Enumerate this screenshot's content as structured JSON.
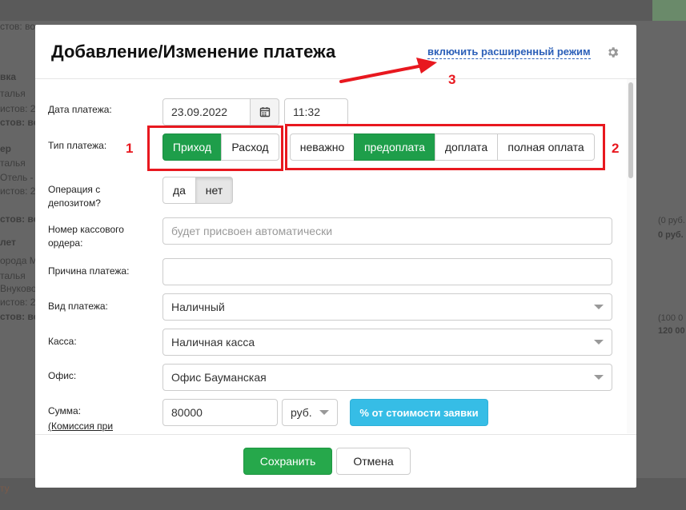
{
  "background": {
    "lines": [
      {
        "text": "стов: во",
        "top": 0
      },
      {
        "text": "вка",
        "top": 0
      },
      {
        "text": "талья",
        "top": 0
      },
      {
        "text": "истов: 2",
        "top": 0
      },
      {
        "text": "стов: во",
        "top": 0
      },
      {
        "text": "ер",
        "top": 0
      },
      {
        "text": "талья",
        "top": 0
      },
      {
        "text": "Отель -",
        "top": 0
      },
      {
        "text": "истов: 2",
        "top": 0
      },
      {
        "text": "стов: во",
        "top": 0
      },
      {
        "text": "лет",
        "top": 0
      },
      {
        "text": "орода М",
        "top": 0
      },
      {
        "text": "талья",
        "top": 0
      },
      {
        "text": "Внуково",
        "top": 0
      },
      {
        "text": "истов: 2",
        "top": 0
      },
      {
        "text": "стов: во",
        "top": 0
      }
    ],
    "right_texts": [
      "(0 руб.",
      "0 руб.",
      "(100 0",
      "120 00"
    ],
    "bottom_link": "ту"
  },
  "modal": {
    "title": "Добавление/Изменение платежа",
    "advanced_mode_link": "включить расширенный режим",
    "fields": {
      "payment_date": {
        "label": "Дата платежа:",
        "date": "23.09.2022",
        "time": "11:32"
      },
      "payment_type": {
        "label": "Тип платежа:",
        "options": [
          "Приход",
          "Расход"
        ],
        "selected": "Приход"
      },
      "payment_kind_toggle": {
        "options": [
          "неважно",
          "предоплата",
          "доплата",
          "полная оплата"
        ],
        "selected": "предоплата"
      },
      "deposit_operation": {
        "label": "Операция с депозитом?",
        "options": [
          "да",
          "нет"
        ],
        "selected": "нет"
      },
      "cash_order_number": {
        "label": "Номер кассового ордера:",
        "placeholder": "будет присвоен автоматически"
      },
      "payment_reason": {
        "label": "Причина платежа:",
        "value": ""
      },
      "payment_method": {
        "label": "Вид платежа:",
        "value": "Наличный"
      },
      "cash_desk": {
        "label": "Касса:",
        "value": "Наличная касса"
      },
      "office": {
        "label": "Офис:",
        "value": "Офис Бауманская"
      },
      "amount": {
        "label": "Сумма:",
        "sublabel": "(Комиссия при",
        "value": "80000",
        "currency": "руб.",
        "percent_button": "% от стоимости заявки"
      }
    },
    "footer": {
      "save": "Сохранить",
      "cancel": "Отмена"
    }
  },
  "annotations": [
    "1",
    "2",
    "3"
  ],
  "colors": {
    "accent_green": "#1e9e4a",
    "info": "#36bde6",
    "link": "#2b5fb8",
    "annotation_red": "#e8181f"
  }
}
